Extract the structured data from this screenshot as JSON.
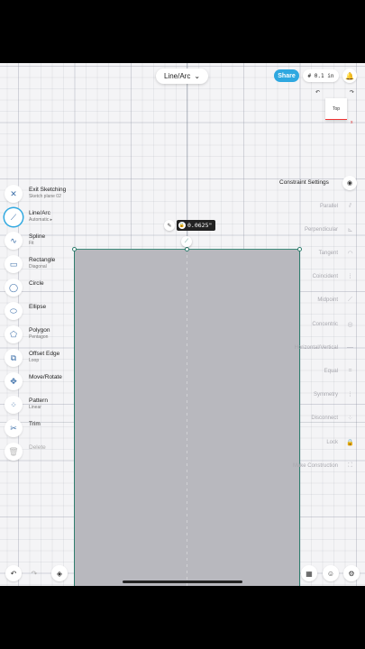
{
  "top_bar": {
    "sketch_tool": "Line/Arc",
    "share_label": "Share",
    "units": "# 0.1 in",
    "bell_icon": "bell-icon"
  },
  "view_cube": {
    "face": "Top",
    "axis": "x"
  },
  "left_toolbar": [
    {
      "label": "Exit Sketching",
      "sub": "Sketch plane 02",
      "icon": "close-icon",
      "glyph": "✕",
      "active": false,
      "disabled": false
    },
    {
      "label": "Line/Arc",
      "sub": "Automatic ▸",
      "icon": "line-arc-icon",
      "glyph": "⟋",
      "active": true,
      "disabled": false
    },
    {
      "label": "Spline",
      "sub": "Fit",
      "icon": "spline-icon",
      "glyph": "∿",
      "active": false,
      "disabled": false
    },
    {
      "label": "Rectangle",
      "sub": "Diagonal",
      "icon": "rectangle-icon",
      "glyph": "▭",
      "active": false,
      "disabled": false
    },
    {
      "label": "Circle",
      "sub": "",
      "icon": "circle-icon",
      "glyph": "◯",
      "active": false,
      "disabled": false
    },
    {
      "label": "Ellipse",
      "sub": "",
      "icon": "ellipse-icon",
      "glyph": "⬭",
      "active": false,
      "disabled": false
    },
    {
      "label": "Polygon",
      "sub": "Pentagon",
      "icon": "polygon-icon",
      "glyph": "⬠",
      "active": false,
      "disabled": false
    },
    {
      "label": "Offset Edge",
      "sub": "Loop",
      "icon": "offset-edge-icon",
      "glyph": "⧉",
      "active": false,
      "disabled": false
    },
    {
      "label": "Move/Rotate",
      "sub": "",
      "icon": "move-rotate-icon",
      "glyph": "✥",
      "active": false,
      "disabled": false
    },
    {
      "label": "Pattern",
      "sub": "Linear",
      "icon": "pattern-icon",
      "glyph": "⁘",
      "active": false,
      "disabled": false
    },
    {
      "label": "Trim",
      "sub": "",
      "icon": "trim-icon",
      "glyph": "✂",
      "active": false,
      "disabled": false
    },
    {
      "label": "Delete",
      "sub": "",
      "icon": "delete-icon",
      "glyph": "🗑",
      "active": false,
      "disabled": true
    }
  ],
  "constraints": {
    "title": "Constraint Settings",
    "items": [
      {
        "label": "Parallel",
        "icon": "parallel-icon",
        "glyph": "⫽"
      },
      {
        "label": "Perpendicular",
        "icon": "perpendicular-icon",
        "glyph": "⊾"
      },
      {
        "label": "Tangent",
        "icon": "tangent-icon",
        "glyph": "◠"
      },
      {
        "label": "Coincident",
        "icon": "coincident-icon",
        "glyph": "⁞"
      },
      {
        "label": "Midpoint",
        "icon": "midpoint-icon",
        "glyph": "⟋"
      },
      {
        "label": "Concentric",
        "icon": "concentric-icon",
        "glyph": "◎"
      },
      {
        "label": "Horizontal/Vertical",
        "icon": "horizontal-vertical-icon",
        "glyph": "—"
      },
      {
        "label": "Equal",
        "icon": "equal-icon",
        "glyph": "="
      },
      {
        "label": "Symmetry",
        "icon": "symmetry-icon",
        "glyph": "⁞"
      },
      {
        "label": "Disconnect",
        "icon": "disconnect-icon",
        "glyph": "⁘"
      },
      {
        "label": "Lock",
        "icon": "lock-icon",
        "glyph": "🔒"
      },
      {
        "label": "Make Construction",
        "icon": "construction-icon",
        "glyph": "⛶"
      }
    ]
  },
  "dimension": {
    "value": "0.0625\""
  },
  "bottom": {
    "undo": "↶",
    "redo": "↷",
    "layers": "◈",
    "materials": "▦",
    "user": "☺",
    "settings": "⚙"
  },
  "colors": {
    "accent": "#2fa8e0",
    "sketch_edge": "#2f7d6e",
    "sketch_fill": "#b8b8be",
    "axis_x": "#dd3333"
  }
}
